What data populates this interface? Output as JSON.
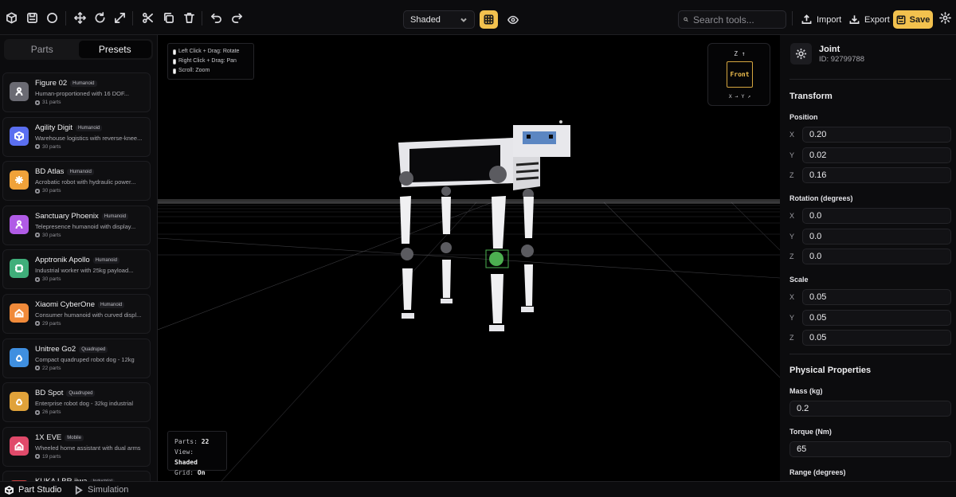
{
  "toolbar": {
    "left_icons": [
      "box-icon",
      "save-disk-icon",
      "circle-icon",
      "move-icon",
      "rotate-icon",
      "scale-icon",
      "cut-icon",
      "copy-icon",
      "trash-icon",
      "undo-icon",
      "redo-icon"
    ],
    "view_mode": "Shaded",
    "search_placeholder": "Search tools...",
    "import_label": "Import",
    "export_label": "Export",
    "save_label": "Save",
    "accent_color": "#f2c14e"
  },
  "sidebar": {
    "tabs": [
      {
        "label": "Parts",
        "active": false
      },
      {
        "label": "Presets",
        "active": true
      }
    ],
    "presets": [
      {
        "name": "Figure 02",
        "badge": "Humanoid",
        "desc": "Human-proportioned with 16 DOF...",
        "parts": "31 parts",
        "icon": "person-icon",
        "color": "#6b6b73"
      },
      {
        "name": "Agility Digit",
        "badge": "Humanoid",
        "desc": "Warehouse logistics with reverse-knee...",
        "parts": "30 parts",
        "icon": "cube-icon",
        "color": "#5b6ff0"
      },
      {
        "name": "BD Atlas",
        "badge": "Humanoid",
        "desc": "Acrobatic robot with hydraulic power...",
        "parts": "30 parts",
        "icon": "sparkle-icon",
        "color": "#f0a23a"
      },
      {
        "name": "Sanctuary Phoenix",
        "badge": "Humanoid",
        "desc": "Telepresence humanoid with display...",
        "parts": "30 parts",
        "icon": "person-icon",
        "color": "#b05be6"
      },
      {
        "name": "Apptronik Apollo",
        "badge": "Humanoid",
        "desc": "Industrial worker with 25kg payload...",
        "parts": "30 parts",
        "icon": "chip-icon",
        "color": "#3fae7a"
      },
      {
        "name": "Xiaomi CyberOne",
        "badge": "Humanoid",
        "desc": "Consumer humanoid with curved displ...",
        "parts": "29 parts",
        "icon": "home-icon",
        "color": "#f08a3a"
      },
      {
        "name": "Unitree Go2",
        "badge": "Quadruped",
        "desc": "Compact quadruped robot dog - 12kg",
        "parts": "22 parts",
        "icon": "paw-icon",
        "color": "#3f8fe0"
      },
      {
        "name": "BD Spot",
        "badge": "Quadruped",
        "desc": "Enterprise robot dog - 32kg industrial",
        "parts": "26 parts",
        "icon": "paw-icon",
        "color": "#e0a23a"
      },
      {
        "name": "1X EVE",
        "badge": "Mobile",
        "desc": "Wheeled home assistant with dual arms",
        "parts": "19 parts",
        "icon": "home-icon",
        "color": "#e04a6a"
      },
      {
        "name": "KUKA LBR iiwa",
        "badge": "Industrial",
        "desc": "",
        "parts": "",
        "icon": "arm-icon",
        "color": "#d04040"
      }
    ]
  },
  "viewport": {
    "hints": [
      "Left Click + Drag: Rotate",
      "Right Click + Drag: Pan",
      "Scroll: Zoom"
    ],
    "axis": {
      "z": "Z ↑",
      "face": "Front",
      "xy": "X → Y ↗"
    },
    "stats": {
      "parts_label": "Parts:",
      "parts_value": "22",
      "view_label": "View:",
      "view_value": "Shaded",
      "grid_label": "Grid:",
      "grid_value": "On"
    }
  },
  "properties": {
    "title": "Joint",
    "id": "ID: 92799788",
    "transform_heading": "Transform",
    "position": {
      "label": "Position",
      "x": "0.20",
      "y": "0.02",
      "z": "0.16"
    },
    "rotation": {
      "label": "Rotation (degrees)",
      "x": "0.0",
      "y": "0.0",
      "z": "0.0"
    },
    "scale": {
      "label": "Scale",
      "x": "0.05",
      "y": "0.05",
      "z": "0.05"
    },
    "physical_heading": "Physical Properties",
    "mass": {
      "label": "Mass (kg)",
      "value": "0.2"
    },
    "torque": {
      "label": "Torque (Nm)",
      "value": "65"
    },
    "range": {
      "label": "Range (degrees)"
    },
    "axis_labels": {
      "x": "X",
      "y": "Y",
      "z": "Z"
    }
  },
  "bottombar": {
    "part_studio": "Part Studio",
    "simulation": "Simulation"
  }
}
